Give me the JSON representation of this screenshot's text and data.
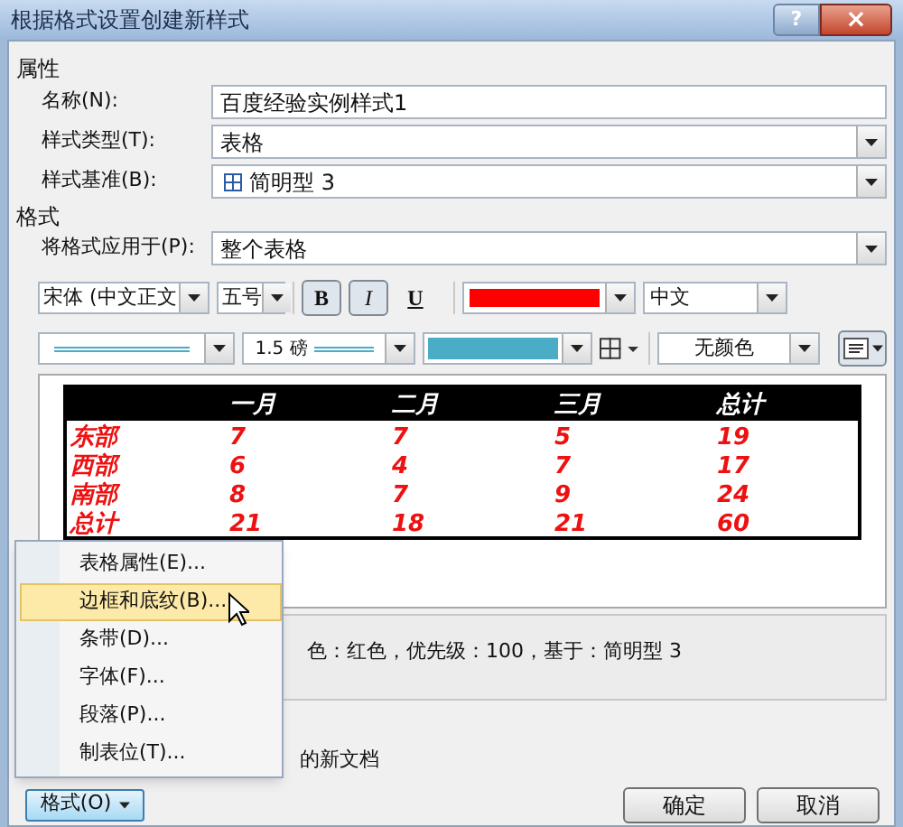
{
  "window": {
    "title": "根据格式设置创建新样式",
    "help": "?",
    "close": "×"
  },
  "properties": {
    "heading": "属性",
    "fields": [
      {
        "kind": "text",
        "label": "名称(N):",
        "value": "百度经验实例样式1"
      },
      {
        "kind": "dropdown",
        "label": "样式类型(T):",
        "value": "表格"
      },
      {
        "kind": "style_dropdown",
        "label": "样式基准(B):",
        "value": "简明型 3"
      }
    ]
  },
  "format": {
    "heading": "格式",
    "apply_to": {
      "label": "将格式应用于(P):",
      "value": "整个表格"
    },
    "font": {
      "name": "宋体 (中文正文",
      "size": "五号",
      "bold": {
        "label": "B",
        "selected": true
      },
      "italic": {
        "label": "I",
        "selected": true
      },
      "underline": {
        "label": "U",
        "selected": false
      },
      "color": "#ff0000",
      "script": "中文"
    },
    "borders": {
      "weight": "1.5 磅",
      "line_sample": {
        "color": "#4bacc6"
      },
      "border_swatch": {
        "color": "#4bacc6"
      },
      "shading": "无颜色"
    }
  },
  "preview": {
    "columns": [
      "",
      "一月",
      "二月",
      "三月",
      "总计"
    ],
    "rows": [
      [
        "东部",
        "7",
        "7",
        "5",
        "19"
      ],
      [
        "西部",
        "6",
        "4",
        "7",
        "17"
      ],
      [
        "南部",
        "8",
        "7",
        "9",
        "24"
      ],
      [
        "总计",
        "21",
        "18",
        "21",
        "60"
      ]
    ]
  },
  "description": "色：红色，优先级：100，基于：简明型 3",
  "option_text": "的新文档",
  "menu": {
    "items": [
      {
        "label": "表格属性(E)...",
        "selected": false
      },
      {
        "label": "边框和底纹(B)...",
        "selected": true
      },
      {
        "label": "条带(D)...",
        "selected": false
      },
      {
        "label": "字体(F)...",
        "selected": false
      },
      {
        "label": "段落(P)...",
        "selected": false
      },
      {
        "label": "制表位(T)...",
        "selected": false
      }
    ]
  },
  "buttons": {
    "format": "格式(O)",
    "ok": "确定",
    "cancel": "取消"
  }
}
